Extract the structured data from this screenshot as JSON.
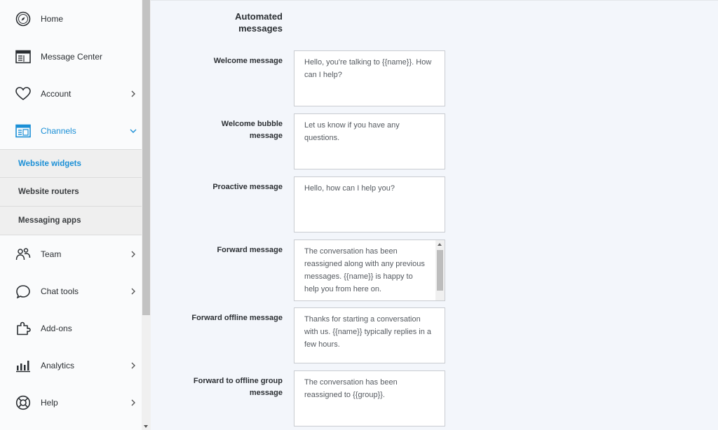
{
  "sidebar": {
    "items": [
      {
        "label": "Home",
        "icon": "compass-icon",
        "has_chevron": false
      },
      {
        "label": "Message Center",
        "icon": "inbox-window-icon",
        "has_chevron": false
      },
      {
        "label": "Account",
        "icon": "heart-icon",
        "has_chevron": true
      },
      {
        "label": "Channels",
        "icon": "channels-window-icon",
        "has_chevron": true,
        "active": true,
        "expanded": true
      }
    ],
    "subitems": [
      {
        "label": "Website widgets",
        "active": true
      },
      {
        "label": "Website routers"
      },
      {
        "label": "Messaging apps"
      }
    ],
    "items_after": [
      {
        "label": "Team",
        "icon": "team-icon",
        "has_chevron": true
      },
      {
        "label": "Chat tools",
        "icon": "chat-bubble-icon",
        "has_chevron": true
      },
      {
        "label": "Add-ons",
        "icon": "puzzle-icon",
        "has_chevron": false
      },
      {
        "label": "Analytics",
        "icon": "bar-chart-icon",
        "has_chevron": true
      },
      {
        "label": "Help",
        "icon": "lifebuoy-icon",
        "has_chevron": true
      }
    ]
  },
  "main": {
    "section_title_line1": "Automated",
    "section_title_line2": "messages",
    "fields": [
      {
        "label": [
          "Welcome message"
        ],
        "value": "Hello, you're talking to {{name}}. How can I help?"
      },
      {
        "label": [
          "Welcome bubble",
          "message"
        ],
        "value": "Let us know if you have any questions."
      },
      {
        "label": [
          "Proactive message"
        ],
        "value": "Hello, how can I help you?"
      },
      {
        "label": [
          "Forward message"
        ],
        "value": "The conversation has been reassigned along with any previous messages. {{name}} is happy to help you from here on."
      },
      {
        "label": [
          "Forward offline message"
        ],
        "value": "Thanks for starting a conversation with us. {{name}} typically replies in a few hours."
      },
      {
        "label": [
          "Forward to offline group",
          "message"
        ],
        "value": "The conversation has been reassigned to {{group}}."
      }
    ]
  },
  "colors": {
    "accent": "#1a8fd6",
    "page_bg": "#f3f6fb",
    "sidebar_bg": "#fafbfc"
  }
}
